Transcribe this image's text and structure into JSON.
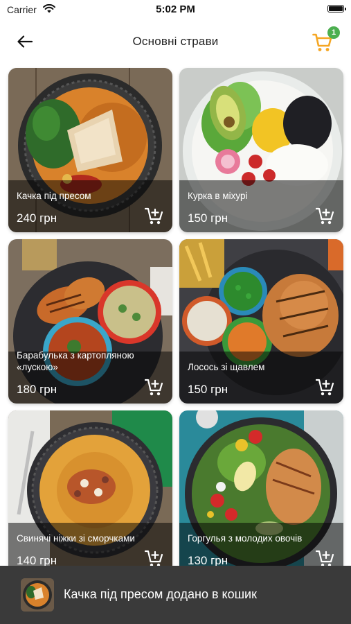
{
  "status_bar": {
    "carrier": "Carrier",
    "time": "5:02 PM"
  },
  "header": {
    "title": "Основні страви",
    "cart_count": "1",
    "accent_color": "#f5a623"
  },
  "products": [
    {
      "name": "Качка під пресом",
      "price": "240 грн"
    },
    {
      "name": "Курка в міхурі",
      "price": "150 грн"
    },
    {
      "name": "Барабулька з картопляною «лускою»",
      "price": "180 грн"
    },
    {
      "name": "Лосось зі щавлем",
      "price": "150 грн"
    },
    {
      "name": "Свинячі ніжки зі сморчками",
      "price": "140 грн"
    },
    {
      "name": "Горгулья з молодих овочів",
      "price": "130 грн"
    }
  ],
  "snackbar": {
    "message": "Качка під пресом додано в кошик"
  }
}
